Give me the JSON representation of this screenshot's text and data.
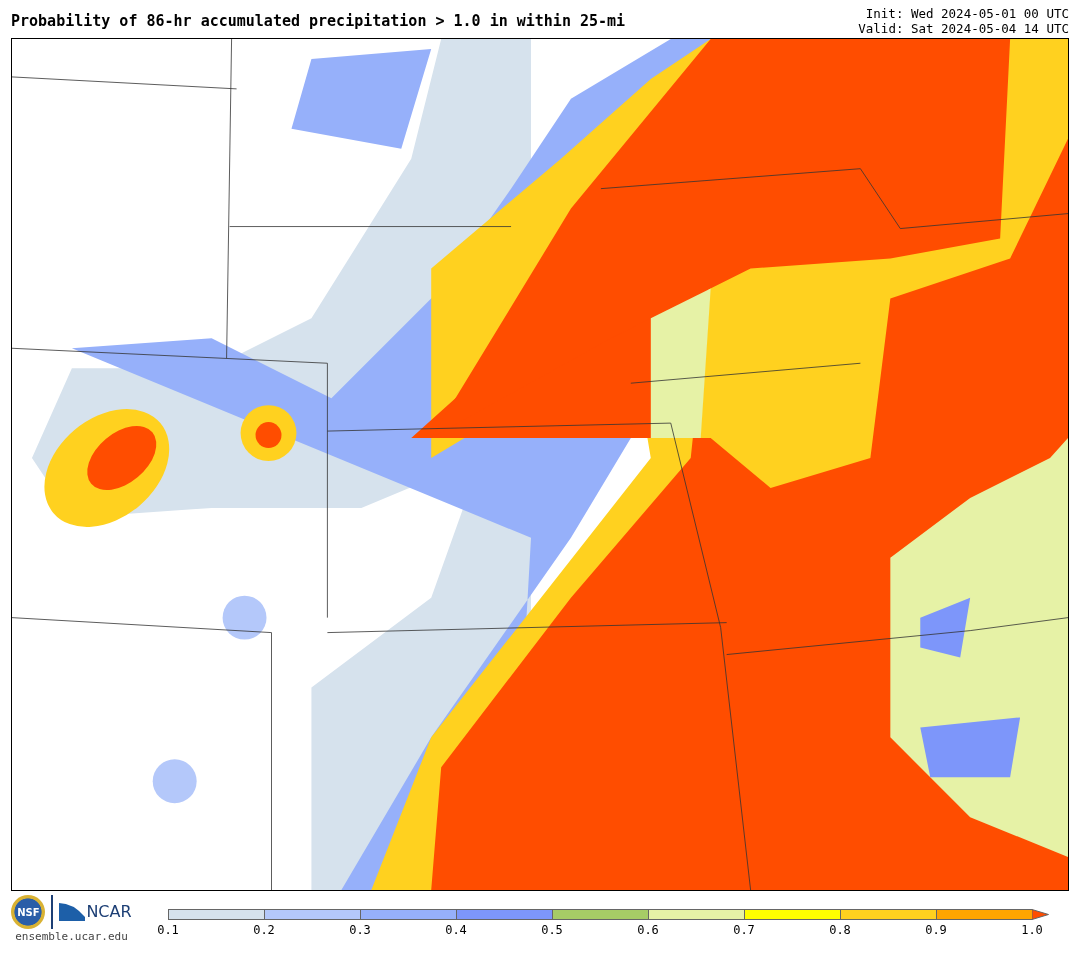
{
  "title": "Probability of 86-hr accumulated precipitation > 1.0 in within 25-mi",
  "init": "Init: Wed 2024-05-01 00 UTC",
  "valid": "Valid: Sat 2024-05-04 14 UTC",
  "logos": {
    "nsf": "NSF",
    "ncar": "NCAR",
    "url": "ensemble.ucar.edu"
  },
  "colorbar": {
    "segments": [
      {
        "color": "#d6e2ed"
      },
      {
        "color": "#b4c8fa"
      },
      {
        "color": "#96b0fa"
      },
      {
        "color": "#7d96fa"
      },
      {
        "color": "#a6cc66"
      },
      {
        "color": "#e6f2a6"
      },
      {
        "color": "#ffff00"
      },
      {
        "color": "#ffd11f"
      },
      {
        "color": "#ffa500"
      },
      {
        "kind": "arrow",
        "color": "#ff4d00"
      }
    ],
    "ticks": [
      "0.1",
      "0.2",
      "0.3",
      "0.4",
      "0.5",
      "0.6",
      "0.7",
      "0.8",
      "0.9",
      "1.0"
    ]
  }
}
